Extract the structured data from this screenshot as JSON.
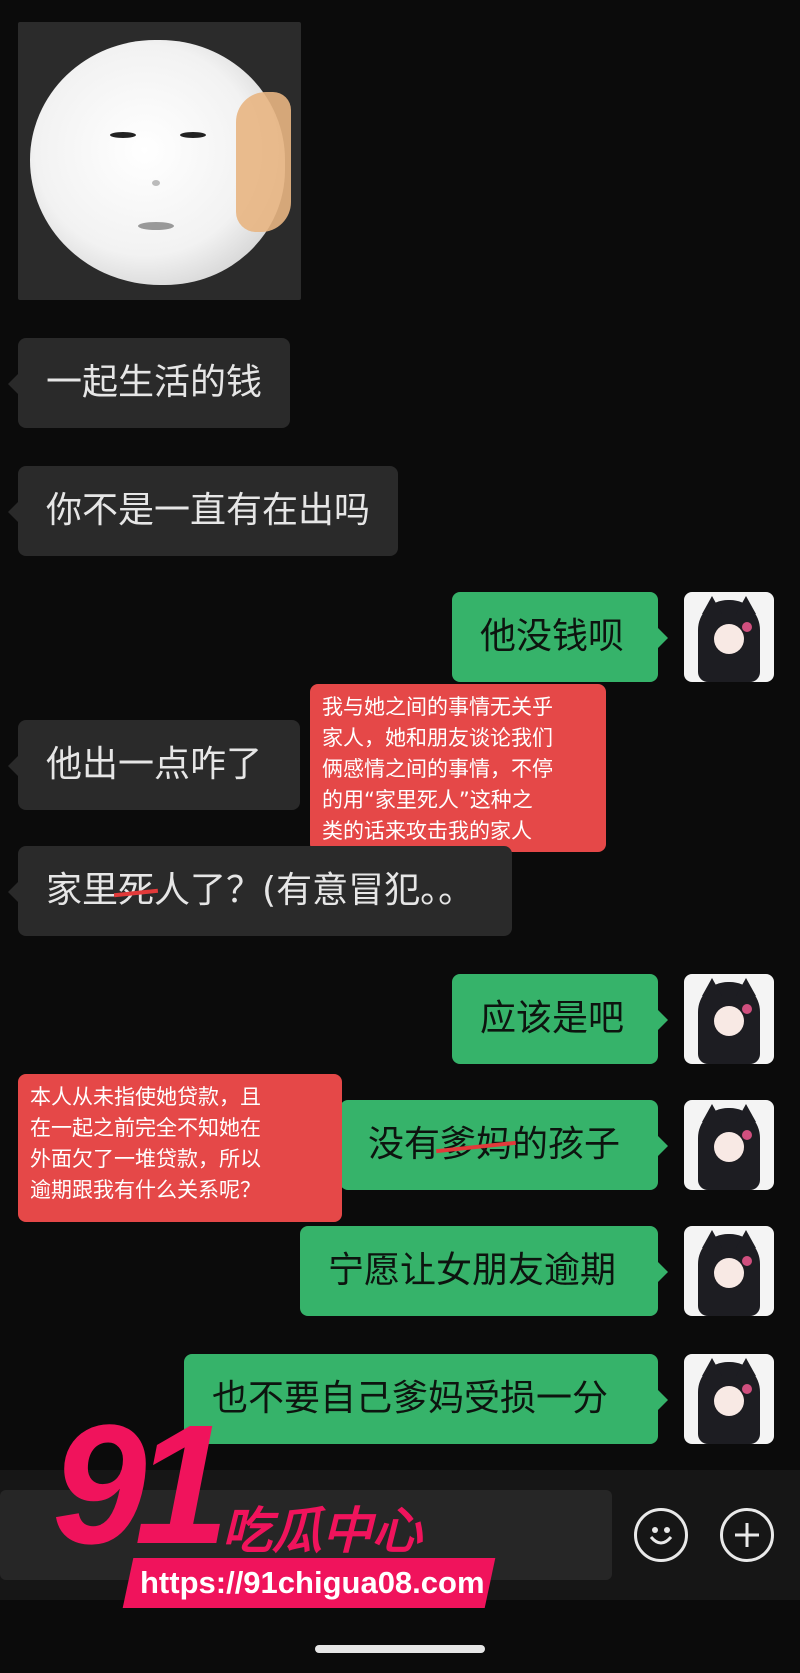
{
  "messages": [
    {
      "side": "in",
      "text": "一起生活的钱"
    },
    {
      "side": "in",
      "text": "你不是一直有在出吗"
    },
    {
      "side": "out",
      "text": "他没钱呗"
    },
    {
      "side": "in",
      "text": "他出一点咋了"
    },
    {
      "side": "in",
      "pre": "家里",
      "struck": "死",
      "post": "人了？(有意冒犯。。"
    },
    {
      "side": "out",
      "text": "应该是吧"
    },
    {
      "side": "out",
      "pre": "没有",
      "struck": "爹妈",
      "post": "的孩子"
    },
    {
      "side": "out",
      "text": "宁愿让女朋友逾期"
    },
    {
      "side": "out",
      "text": "也不要自己爹妈受损一分"
    }
  ],
  "annotations": [
    {
      "lines": [
        "我与她之间的事情无关乎",
        "家人，她和朋友谈论我们",
        "俩感情之间的事情，不停",
        "的用“家里死人”这种之",
        "类的话来攻击我的家人"
      ]
    },
    {
      "lines": [
        "本人从未指使她贷款，且",
        "在一起之前完全不知她在",
        "外面欠了一堆贷款，所以",
        "逾期跟我有什么关系呢？"
      ]
    }
  ],
  "watermark": {
    "number": "91",
    "brand": "吃瓜中心",
    "url": "https://91chigua08.com"
  },
  "icons": {
    "emoji": "smiley-face-icon",
    "plus": "plus-icon"
  },
  "colors": {
    "background": "#0b0b0b",
    "incoming_bubble": "#2a2a2a",
    "outgoing_bubble": "#36b36a",
    "annotation": "#e54848",
    "watermark": "#f0135c"
  }
}
